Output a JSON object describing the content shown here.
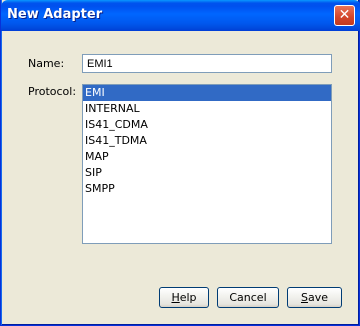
{
  "window": {
    "title": "New Adapter"
  },
  "name_field": {
    "label": "Name:",
    "value": "EMI1"
  },
  "protocol": {
    "label": "Protocol:",
    "selected": "EMI",
    "options": [
      "EMI",
      "INTERNAL",
      "IS41_CDMA",
      "IS41_TDMA",
      "MAP",
      "SIP",
      "SMPP"
    ]
  },
  "buttons": {
    "help": {
      "mnemonic": "H",
      "rest": "elp"
    },
    "cancel": "Cancel",
    "save": {
      "mnemonic": "S",
      "rest": "ave"
    }
  },
  "colors": {
    "selection": "#316ac5",
    "titlebar": "#0058ee",
    "dialog_bg": "#ece9d8"
  }
}
